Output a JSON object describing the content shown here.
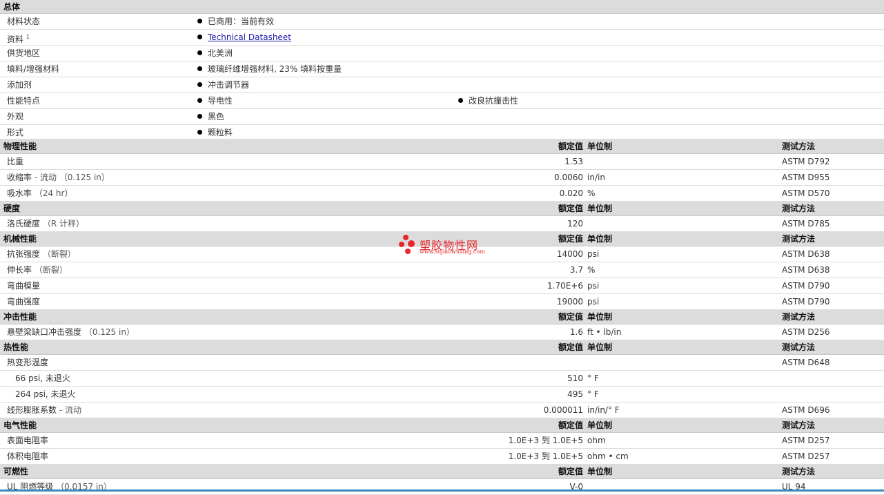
{
  "general": {
    "title": "总体",
    "rows": [
      {
        "label": "材料状态",
        "values": [
          "已商用：当前有效"
        ]
      },
      {
        "label": "资料",
        "sup": "1",
        "link": "Technical Datasheet"
      },
      {
        "label": "供货地区",
        "values": [
          "北美洲"
        ]
      },
      {
        "label": "填料/增强材料",
        "values": [
          "玻璃纤维增强材料, 23% 填料按重量"
        ]
      },
      {
        "label": "添加剂",
        "values": [
          "冲击调节器"
        ]
      },
      {
        "label": "性能特点",
        "values": [
          "导电性",
          "改良抗撞击性"
        ]
      },
      {
        "label": "外观",
        "values": [
          "黑色"
        ]
      },
      {
        "label": "形式",
        "values": [
          "颗粒料"
        ]
      }
    ]
  },
  "headers": {
    "value": "额定值",
    "unit": "单位制",
    "test": "测试方法"
  },
  "sections": [
    {
      "title": "物理性能",
      "rows": [
        {
          "label": "比重",
          "note": "",
          "value": "1.53",
          "unit": "",
          "test": "ASTM D792"
        },
        {
          "label": "收缩率",
          "note": " - 流动 （0.125 in）",
          "value": "0.0060",
          "unit": "in/in",
          "test": "ASTM D955"
        },
        {
          "label": "吸水率",
          "note": " （24 hr）",
          "value": "0.020",
          "unit": "%",
          "test": "ASTM D570"
        }
      ]
    },
    {
      "title": "硬度",
      "rows": [
        {
          "label": "洛氏硬度",
          "note": " （R 计秤）",
          "value": "120",
          "unit": "",
          "test": "ASTM D785"
        }
      ]
    },
    {
      "title": "机械性能",
      "rows": [
        {
          "label": "抗张强度",
          "note": " （断裂）",
          "value": "14000",
          "unit": "psi",
          "test": "ASTM D638"
        },
        {
          "label": "伸长率",
          "note": " （断裂）",
          "value": "3.7",
          "unit": "%",
          "test": "ASTM D638"
        },
        {
          "label": "弯曲模量",
          "note": "",
          "value": "1.70E+6",
          "unit": "psi",
          "test": "ASTM D790"
        },
        {
          "label": "弯曲强度",
          "note": "",
          "value": "19000",
          "unit": "psi",
          "test": "ASTM D790"
        }
      ]
    },
    {
      "title": "冲击性能",
      "rows": [
        {
          "label": "悬壁梁缺口冲击强度",
          "note": " （0.125 in）",
          "value": "1.6",
          "unit": "ft • lb/in",
          "test": "ASTM D256"
        }
      ]
    },
    {
      "title": "热性能",
      "rows": [
        {
          "label": "热变形温度",
          "note": "",
          "value": "",
          "unit": "",
          "test": "ASTM D648"
        },
        {
          "label": "66 psi, 未退火",
          "note": "",
          "value": "510",
          "unit": "° F",
          "test": "",
          "sub": true
        },
        {
          "label": "264 psi, 未退火",
          "note": "",
          "value": "495",
          "unit": "° F",
          "test": "",
          "sub": true
        },
        {
          "label": "线形膨胀系数",
          "note": " - 流动",
          "value": "0.000011",
          "unit": "in/in/° F",
          "test": "ASTM D696"
        }
      ]
    },
    {
      "title": "电气性能",
      "rows": [
        {
          "label": "表面电阻率",
          "note": "",
          "value": "1.0E+3 到  1.0E+5",
          "unit": "ohm",
          "test": "ASTM D257"
        },
        {
          "label": "体积电阻率",
          "note": "",
          "value": "1.0E+3 到  1.0E+5",
          "unit": "ohm • cm",
          "test": "ASTM D257"
        }
      ]
    },
    {
      "title": "可燃性",
      "rows": [
        {
          "label": "UL 阻燃等级",
          "note": " （0.0157 in）",
          "value": "V-0",
          "unit": "",
          "test": "UL 94"
        }
      ]
    }
  ],
  "watermark": {
    "title": "塑胶物性网",
    "url": "www.sujiaowuxing.com",
    "color": "#e8262c"
  }
}
